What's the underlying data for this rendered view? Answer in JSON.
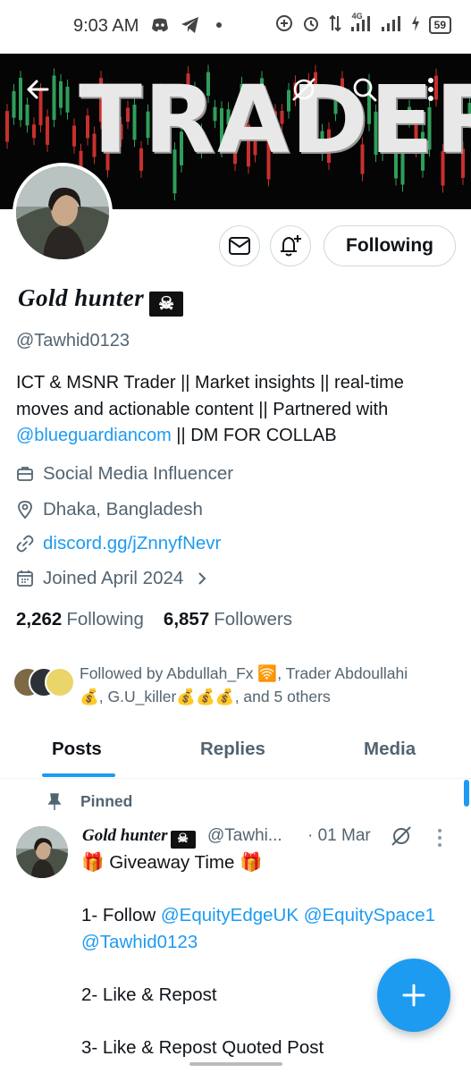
{
  "status_bar": {
    "time": "9:03 AM",
    "network": "4G",
    "battery": "59"
  },
  "banner": {
    "title": "TRADER"
  },
  "profile": {
    "display_name": "Gold hunter",
    "handle": "@Tawhid0123",
    "bio_lines": [
      "ICT & MSNR Trader || Market insights || real-time",
      "moves  and actionable content || Partnered with"
    ],
    "bio_mention": "@blueguardiancom",
    "bio_tail": " || DM FOR COLLAB",
    "category": "Social Media Influencer",
    "location": "Dhaka, Bangladesh",
    "url": "discord.gg/jZnnyfNevr",
    "joined": "Joined April 2024",
    "following_count": "2,262",
    "following_label": "Following",
    "followers_count": "6,857",
    "followers_label": "Followers",
    "followed_by_line1": "Followed by Abdullah_Fx 🛜, Trader Abdoullahi",
    "followed_by_line2": "💰, G.U_killer💰💰💰, and 5 others"
  },
  "actions": {
    "following_button": "Following"
  },
  "tabs": [
    {
      "label": "Posts",
      "active": true
    },
    {
      "label": "Replies",
      "active": false
    },
    {
      "label": "Media",
      "active": false
    }
  ],
  "pinned_tweet": {
    "pinned_label": "Pinned",
    "author_name": "Gold hunter",
    "author_handle": "@Tawhi...",
    "time": "· 01 Mar",
    "lines": [
      "🎁 Giveaway Time 🎁",
      "",
      "1- Follow ",
      "@Tawhid0123",
      "",
      "2- Like & Repost",
      "",
      "3- Like & Repost Quoted Post"
    ],
    "mentions_line": "@EquityEdgeUK @EquitySpace1"
  },
  "colors": {
    "accent": "#1d9bf0",
    "text_primary": "#0f1419",
    "text_secondary": "#536471",
    "banner_bg": "#050505"
  },
  "icons": {
    "back": "arrow-left-icon",
    "grok": "grok-icon",
    "search": "search-icon",
    "more": "more-vertical-icon",
    "mail": "envelope-icon",
    "notify": "bell-plus-icon",
    "work": "briefcase-icon",
    "location": "pin-icon",
    "url": "link-icon",
    "joined": "calendar-icon",
    "pinned": "pushpin-icon",
    "fab": "plus-icon"
  }
}
